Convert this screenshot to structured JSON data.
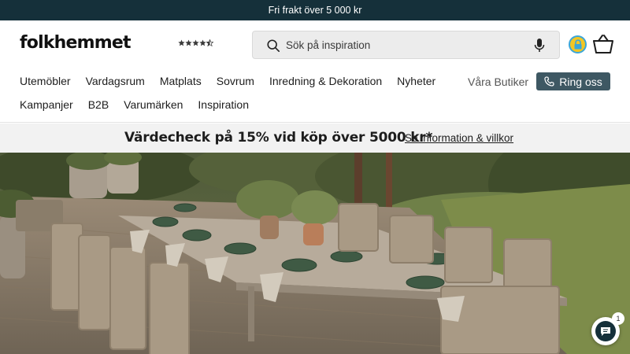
{
  "topbar": {
    "text": "Fri frakt över 5 000 kr"
  },
  "header": {
    "logo": "folkhemmet",
    "rating_stars": 4.5,
    "search": {
      "placeholder": "Sök på inspiration"
    },
    "icons": [
      "search-icon",
      "microphone-icon",
      "trust-badge-icon",
      "basket-icon"
    ]
  },
  "nav": {
    "row1": [
      "Utemöbler",
      "Vardagsrum",
      "Matplats",
      "Sovrum",
      "Inredning & Dekoration",
      "Nyheter"
    ],
    "row2": [
      "Kampanjer",
      "B2B",
      "Varumärken",
      "Inspiration"
    ],
    "stores": "Våra Butiker",
    "call": "Ring oss"
  },
  "promo": {
    "text": "Värdecheck på 15% vid köp över 5000 kr*",
    "link": "Se information & villkor"
  },
  "chat": {
    "count": "1"
  },
  "colors": {
    "topbar": "#15303a",
    "accent_button": "#3e5863",
    "promo_bg": "#f2f2f2"
  }
}
